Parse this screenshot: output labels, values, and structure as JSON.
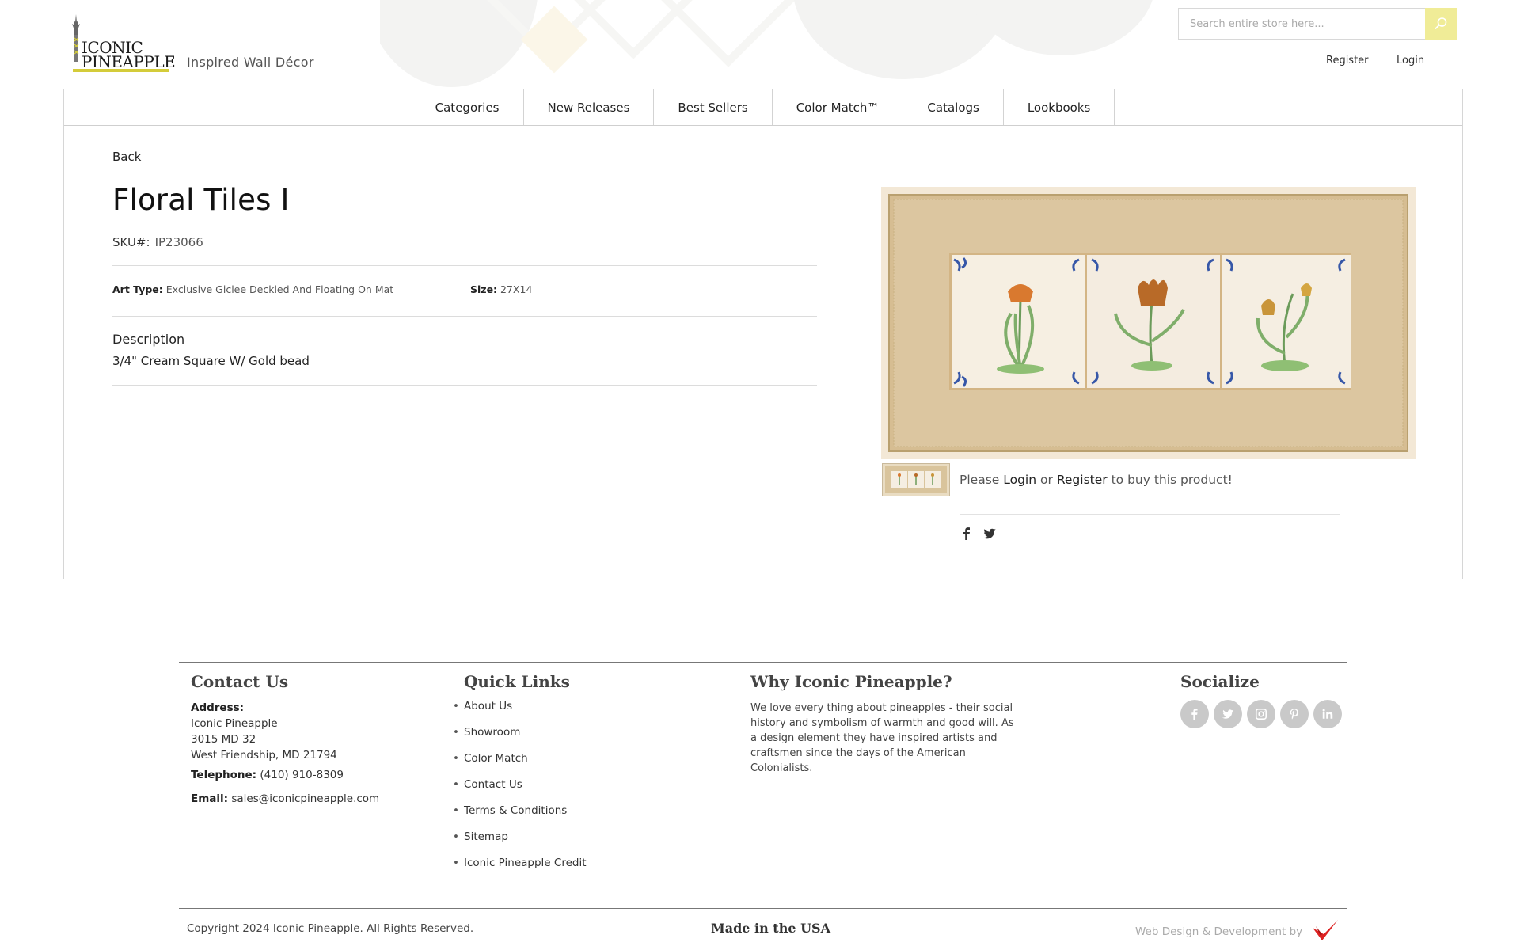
{
  "brand": {
    "logo_line1": "ICONIC",
    "logo_line2": "PINEAPPLE",
    "tagline": "Inspired Wall Décor",
    "accent_color": "#d4cc3a"
  },
  "header": {
    "search_placeholder": "Search entire store here...",
    "search_icon": "magnifier-icon",
    "register_label": "Register",
    "login_label": "Login"
  },
  "nav": {
    "items": [
      {
        "label": "Categories"
      },
      {
        "label": "New Releases"
      },
      {
        "label": "Best Sellers"
      },
      {
        "label": "Color Match™"
      },
      {
        "label": "Catalogs"
      },
      {
        "label": "Lookbooks"
      }
    ]
  },
  "product": {
    "back_label": "Back",
    "title": "Floral Tiles I",
    "sku_label": "SKU#:",
    "sku_value": "IP23066",
    "art_type_label": "Art Type:",
    "art_type_value": "Exclusive Giclee Deckled And Floating On Mat",
    "size_label": "Size:",
    "size_value": "27X14",
    "description_heading": "Description",
    "description_text": "3/4\" Cream Square W/ Gold bead",
    "buy_prefix": "Please",
    "buy_login": "Login",
    "buy_or": "or",
    "buy_register": "Register",
    "buy_suffix": "to buy this product!",
    "share_icons": [
      "facebook-icon",
      "twitter-icon"
    ]
  },
  "footer": {
    "contact": {
      "heading": "Contact Us",
      "address_label": "Address:",
      "address_lines": [
        "Iconic Pineapple",
        "3015 MD 32",
        "West Friendship, MD 21794"
      ],
      "telephone_label": "Telephone:",
      "telephone_value": "(410) 910-8309",
      "email_label": "Email:",
      "email_value": "sales@iconicpineapple.com"
    },
    "quick_links": {
      "heading": "Quick Links",
      "items": [
        "About Us",
        "Showroom",
        "Color Match",
        "Contact Us",
        "Terms & Conditions",
        "Sitemap",
        "Iconic Pineapple Credit"
      ]
    },
    "why": {
      "heading": "Why Iconic Pineapple?",
      "text": "We love every thing about pineapples - their social history and symbolism of warmth and good will. As a design element they have inspired artists and craftsmen since the days of the American Colonialists."
    },
    "socialize": {
      "heading": "Socialize",
      "icons": [
        "facebook-icon",
        "twitter-icon",
        "instagram-icon",
        "pinterest-icon",
        "linkedin-icon"
      ]
    },
    "copyright": "Copyright 2024 Iconic Pineapple. All Rights Reserved.",
    "made_in": "Made in the USA",
    "credit": "Web Design & Development by"
  }
}
